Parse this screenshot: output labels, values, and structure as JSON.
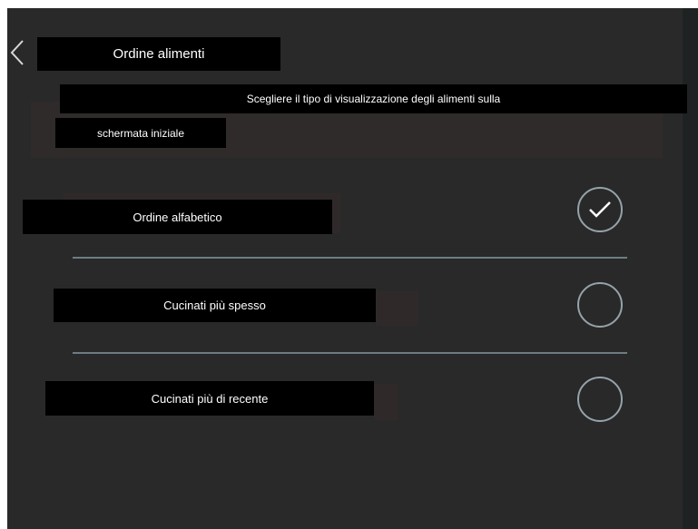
{
  "header": {
    "title": "Ordine alimenti",
    "back_icon": "chevron-left-icon"
  },
  "description": {
    "line1": "Scegliere il tipo di visualizzazione degli alimenti sulla",
    "line2": "schermata iniziale"
  },
  "options": [
    {
      "label": "Ordine alfabetico",
      "selected": true
    },
    {
      "label": "Cucinati più spesso",
      "selected": false
    },
    {
      "label": "Cucinati più di recente",
      "selected": false
    }
  ],
  "colors": {
    "background": "#292929",
    "label_box": "#000000",
    "text": "#ffffff",
    "radio_border": "#95a3a8",
    "divider": "#6e7d82"
  }
}
